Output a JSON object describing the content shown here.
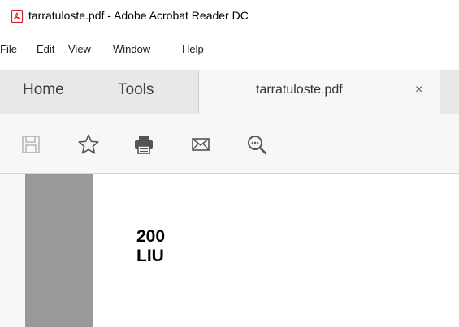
{
  "window": {
    "title": "tarratuloste.pdf - Adobe Acrobat Reader DC",
    "app_icon": "acrobat-pdf-icon"
  },
  "menu": {
    "items": [
      "File",
      "Edit",
      "View",
      "Window",
      "Help"
    ]
  },
  "tabs": {
    "home_label": "Home",
    "tools_label": "Tools",
    "document_label": "tarratuloste.pdf",
    "close_glyph": "×"
  },
  "toolbar": {
    "icons": [
      "save-icon",
      "bookmark-star-icon",
      "print-icon",
      "email-icon",
      "zoom-search-icon"
    ]
  },
  "document": {
    "lines": [
      "200",
      "LIU"
    ]
  },
  "colors": {
    "accent_red": "#d7201e",
    "tab_bar": "#e8e8e8",
    "toolbar_bg": "#f7f7f7",
    "page_strip": "#999999",
    "icon_gray": "#555555"
  }
}
